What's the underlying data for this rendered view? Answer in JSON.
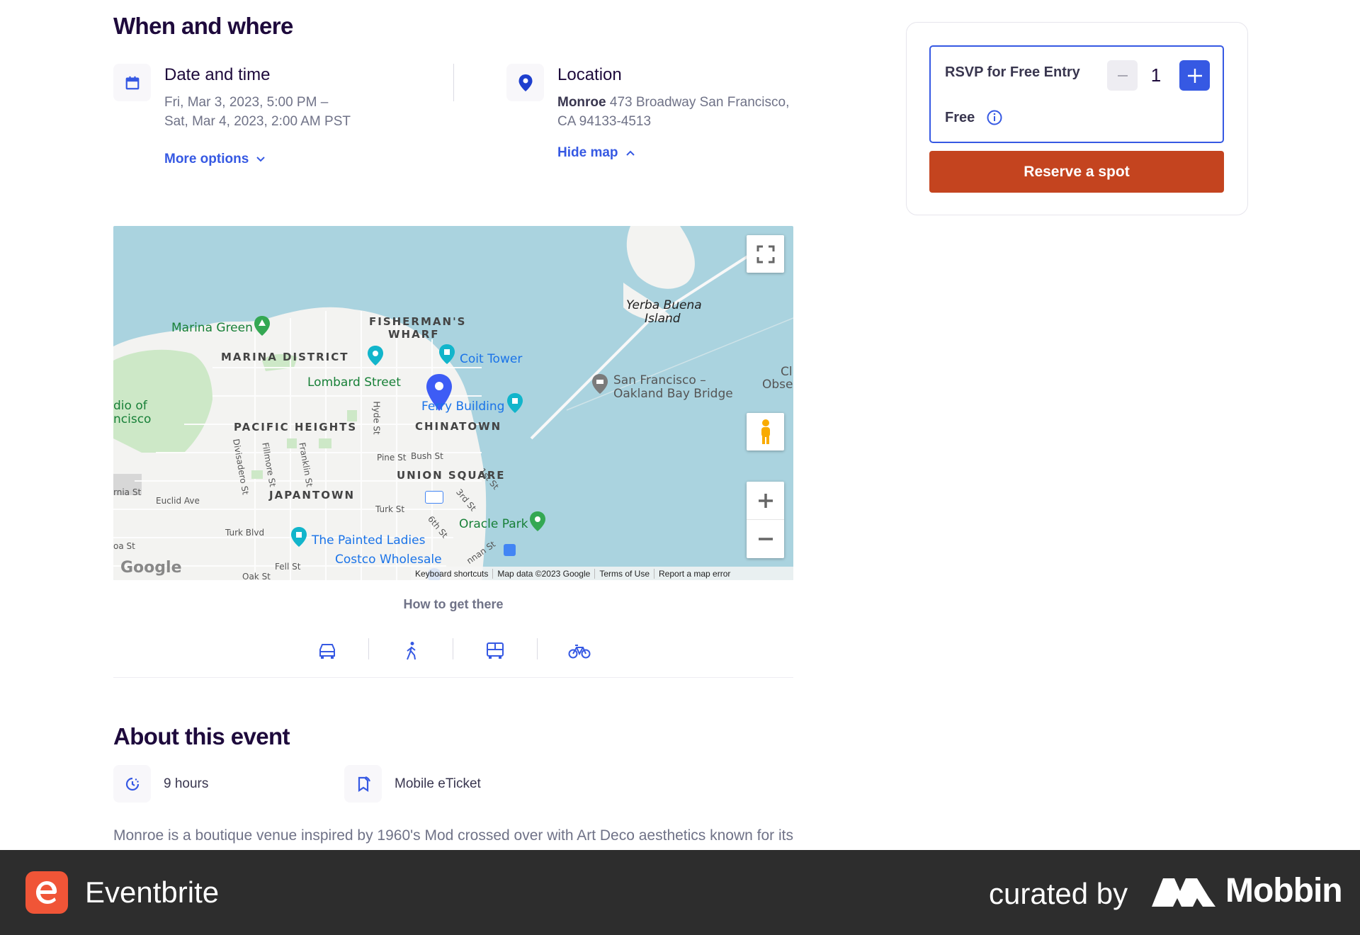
{
  "when_where": {
    "title": "When and where",
    "date": {
      "title": "Date and time",
      "line1": "Fri, Mar 3, 2023, 5:00 PM –",
      "line2": "Sat, Mar 4, 2023, 2:00 AM PST",
      "more_options": "More options"
    },
    "location": {
      "title": "Location",
      "venue": "Monroe",
      "address1": " 473 Broadway San Francisco,",
      "address2": "CA 94133-4513",
      "hide_map": "Hide map"
    }
  },
  "map": {
    "labels": {
      "marina_green": "Marina Green",
      "fishermans_wharf_1": "FISHERMAN'S",
      "fishermans_wharf_2": "WHARF",
      "marina_district": "MARINA DISTRICT",
      "coit_tower": "Coit Tower",
      "lombard_street": "Lombard Street",
      "ferry_building": "Ferry Building",
      "pacific_heights": "PACIFIC HEIGHTS",
      "chinatown": "CHINATOWN",
      "union_square": "UNION SQUARE",
      "japantown": "JAPANTOWN",
      "oracle_park": "Oracle Park",
      "painted_ladies": "The Painted Ladies",
      "costco": "Costco Wholesale",
      "yerba_buena_1": "Yerba Buena",
      "yerba_buena_2": "Island",
      "bay_bridge_1": "San Francisco –",
      "bay_bridge_2": "Oakland Bay Bridge",
      "presidio_1": "dio of",
      "presidio_2": "ncisco",
      "obse_1": "Cl",
      "obse_2": "Obse",
      "pine_st": "Pine St",
      "bush_st": "Bush St",
      "hyde_st": "Hyde St",
      "euclid_ave": "Euclid Ave",
      "turk_st": "Turk St",
      "turk_blvd": "Turk Blvd",
      "fell_st": "Fell St",
      "oak_st": "Oak St",
      "divisadero": "Divisadero St",
      "fillmore": "Fillmore St",
      "franklin": "Franklin St",
      "first_st": "1st St",
      "third_st": "3rd St",
      "sixth_st": "6th St",
      "brannan": "nnan St",
      "california": "rnia St",
      "oa_st": "oa St"
    },
    "google": "Google",
    "footer": {
      "shortcuts": "Keyboard shortcuts",
      "map_data": "Map data ©2023 Google",
      "terms": "Terms of Use",
      "report": "Report a map error"
    }
  },
  "how_to": "How to get there",
  "transport_icons": [
    "car-icon",
    "walk-icon",
    "bus-icon",
    "bike-icon"
  ],
  "about": {
    "title": "About this event",
    "duration": "9 hours",
    "ticket_type": "Mobile eTicket",
    "description": "Monroe is a boutique venue inspired by 1960's Mod crossed over with Art Deco aesthetics known for its"
  },
  "rsvp": {
    "name": "RSVP for Free Entry",
    "price": "Free",
    "quantity": "1",
    "reserve_label": "Reserve a spot"
  },
  "bottom_bar": {
    "brand": "Eventbrite",
    "curated": "curated by",
    "mobbin": "Mobbin"
  },
  "colors": {
    "accent": "#3659e3",
    "reserve": "#c4441f",
    "heading": "#1e0a3c",
    "muted": "#6f7287",
    "water": "#aad3df",
    "brand": "#f05537"
  }
}
